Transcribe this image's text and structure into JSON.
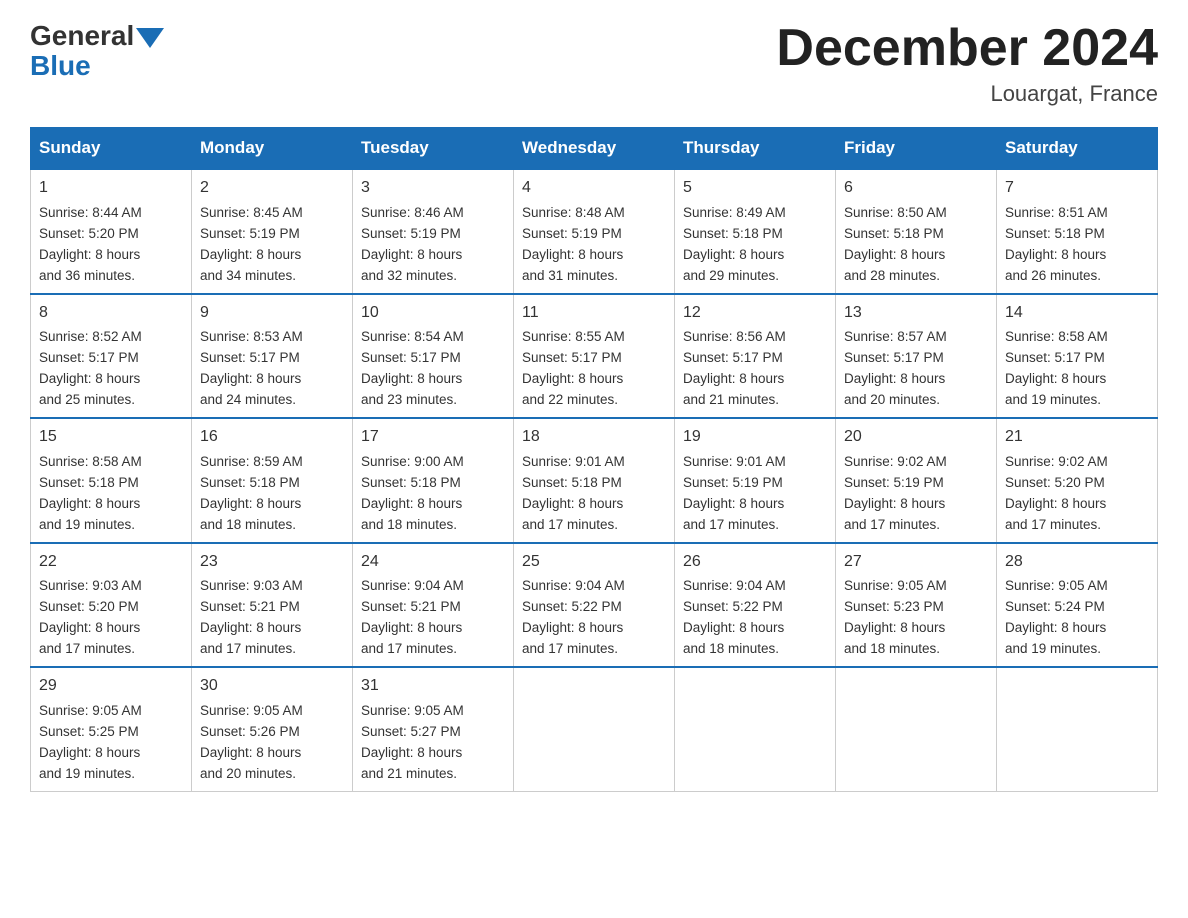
{
  "header": {
    "logo_general": "General",
    "logo_blue": "Blue",
    "month_title": "December 2024",
    "location": "Louargat, France"
  },
  "days_of_week": [
    "Sunday",
    "Monday",
    "Tuesday",
    "Wednesday",
    "Thursday",
    "Friday",
    "Saturday"
  ],
  "weeks": [
    [
      {
        "day": "1",
        "sunrise": "8:44 AM",
        "sunset": "5:20 PM",
        "daylight": "8 hours and 36 minutes."
      },
      {
        "day": "2",
        "sunrise": "8:45 AM",
        "sunset": "5:19 PM",
        "daylight": "8 hours and 34 minutes."
      },
      {
        "day": "3",
        "sunrise": "8:46 AM",
        "sunset": "5:19 PM",
        "daylight": "8 hours and 32 minutes."
      },
      {
        "day": "4",
        "sunrise": "8:48 AM",
        "sunset": "5:19 PM",
        "daylight": "8 hours and 31 minutes."
      },
      {
        "day": "5",
        "sunrise": "8:49 AM",
        "sunset": "5:18 PM",
        "daylight": "8 hours and 29 minutes."
      },
      {
        "day": "6",
        "sunrise": "8:50 AM",
        "sunset": "5:18 PM",
        "daylight": "8 hours and 28 minutes."
      },
      {
        "day": "7",
        "sunrise": "8:51 AM",
        "sunset": "5:18 PM",
        "daylight": "8 hours and 26 minutes."
      }
    ],
    [
      {
        "day": "8",
        "sunrise": "8:52 AM",
        "sunset": "5:17 PM",
        "daylight": "8 hours and 25 minutes."
      },
      {
        "day": "9",
        "sunrise": "8:53 AM",
        "sunset": "5:17 PM",
        "daylight": "8 hours and 24 minutes."
      },
      {
        "day": "10",
        "sunrise": "8:54 AM",
        "sunset": "5:17 PM",
        "daylight": "8 hours and 23 minutes."
      },
      {
        "day": "11",
        "sunrise": "8:55 AM",
        "sunset": "5:17 PM",
        "daylight": "8 hours and 22 minutes."
      },
      {
        "day": "12",
        "sunrise": "8:56 AM",
        "sunset": "5:17 PM",
        "daylight": "8 hours and 21 minutes."
      },
      {
        "day": "13",
        "sunrise": "8:57 AM",
        "sunset": "5:17 PM",
        "daylight": "8 hours and 20 minutes."
      },
      {
        "day": "14",
        "sunrise": "8:58 AM",
        "sunset": "5:17 PM",
        "daylight": "8 hours and 19 minutes."
      }
    ],
    [
      {
        "day": "15",
        "sunrise": "8:58 AM",
        "sunset": "5:18 PM",
        "daylight": "8 hours and 19 minutes."
      },
      {
        "day": "16",
        "sunrise": "8:59 AM",
        "sunset": "5:18 PM",
        "daylight": "8 hours and 18 minutes."
      },
      {
        "day": "17",
        "sunrise": "9:00 AM",
        "sunset": "5:18 PM",
        "daylight": "8 hours and 18 minutes."
      },
      {
        "day": "18",
        "sunrise": "9:01 AM",
        "sunset": "5:18 PM",
        "daylight": "8 hours and 17 minutes."
      },
      {
        "day": "19",
        "sunrise": "9:01 AM",
        "sunset": "5:19 PM",
        "daylight": "8 hours and 17 minutes."
      },
      {
        "day": "20",
        "sunrise": "9:02 AM",
        "sunset": "5:19 PM",
        "daylight": "8 hours and 17 minutes."
      },
      {
        "day": "21",
        "sunrise": "9:02 AM",
        "sunset": "5:20 PM",
        "daylight": "8 hours and 17 minutes."
      }
    ],
    [
      {
        "day": "22",
        "sunrise": "9:03 AM",
        "sunset": "5:20 PM",
        "daylight": "8 hours and 17 minutes."
      },
      {
        "day": "23",
        "sunrise": "9:03 AM",
        "sunset": "5:21 PM",
        "daylight": "8 hours and 17 minutes."
      },
      {
        "day": "24",
        "sunrise": "9:04 AM",
        "sunset": "5:21 PM",
        "daylight": "8 hours and 17 minutes."
      },
      {
        "day": "25",
        "sunrise": "9:04 AM",
        "sunset": "5:22 PM",
        "daylight": "8 hours and 17 minutes."
      },
      {
        "day": "26",
        "sunrise": "9:04 AM",
        "sunset": "5:22 PM",
        "daylight": "8 hours and 18 minutes."
      },
      {
        "day": "27",
        "sunrise": "9:05 AM",
        "sunset": "5:23 PM",
        "daylight": "8 hours and 18 minutes."
      },
      {
        "day": "28",
        "sunrise": "9:05 AM",
        "sunset": "5:24 PM",
        "daylight": "8 hours and 19 minutes."
      }
    ],
    [
      {
        "day": "29",
        "sunrise": "9:05 AM",
        "sunset": "5:25 PM",
        "daylight": "8 hours and 19 minutes."
      },
      {
        "day": "30",
        "sunrise": "9:05 AM",
        "sunset": "5:26 PM",
        "daylight": "8 hours and 20 minutes."
      },
      {
        "day": "31",
        "sunrise": "9:05 AM",
        "sunset": "5:27 PM",
        "daylight": "8 hours and 21 minutes."
      },
      null,
      null,
      null,
      null
    ]
  ],
  "labels": {
    "sunrise": "Sunrise:",
    "sunset": "Sunset:",
    "daylight": "Daylight:"
  }
}
